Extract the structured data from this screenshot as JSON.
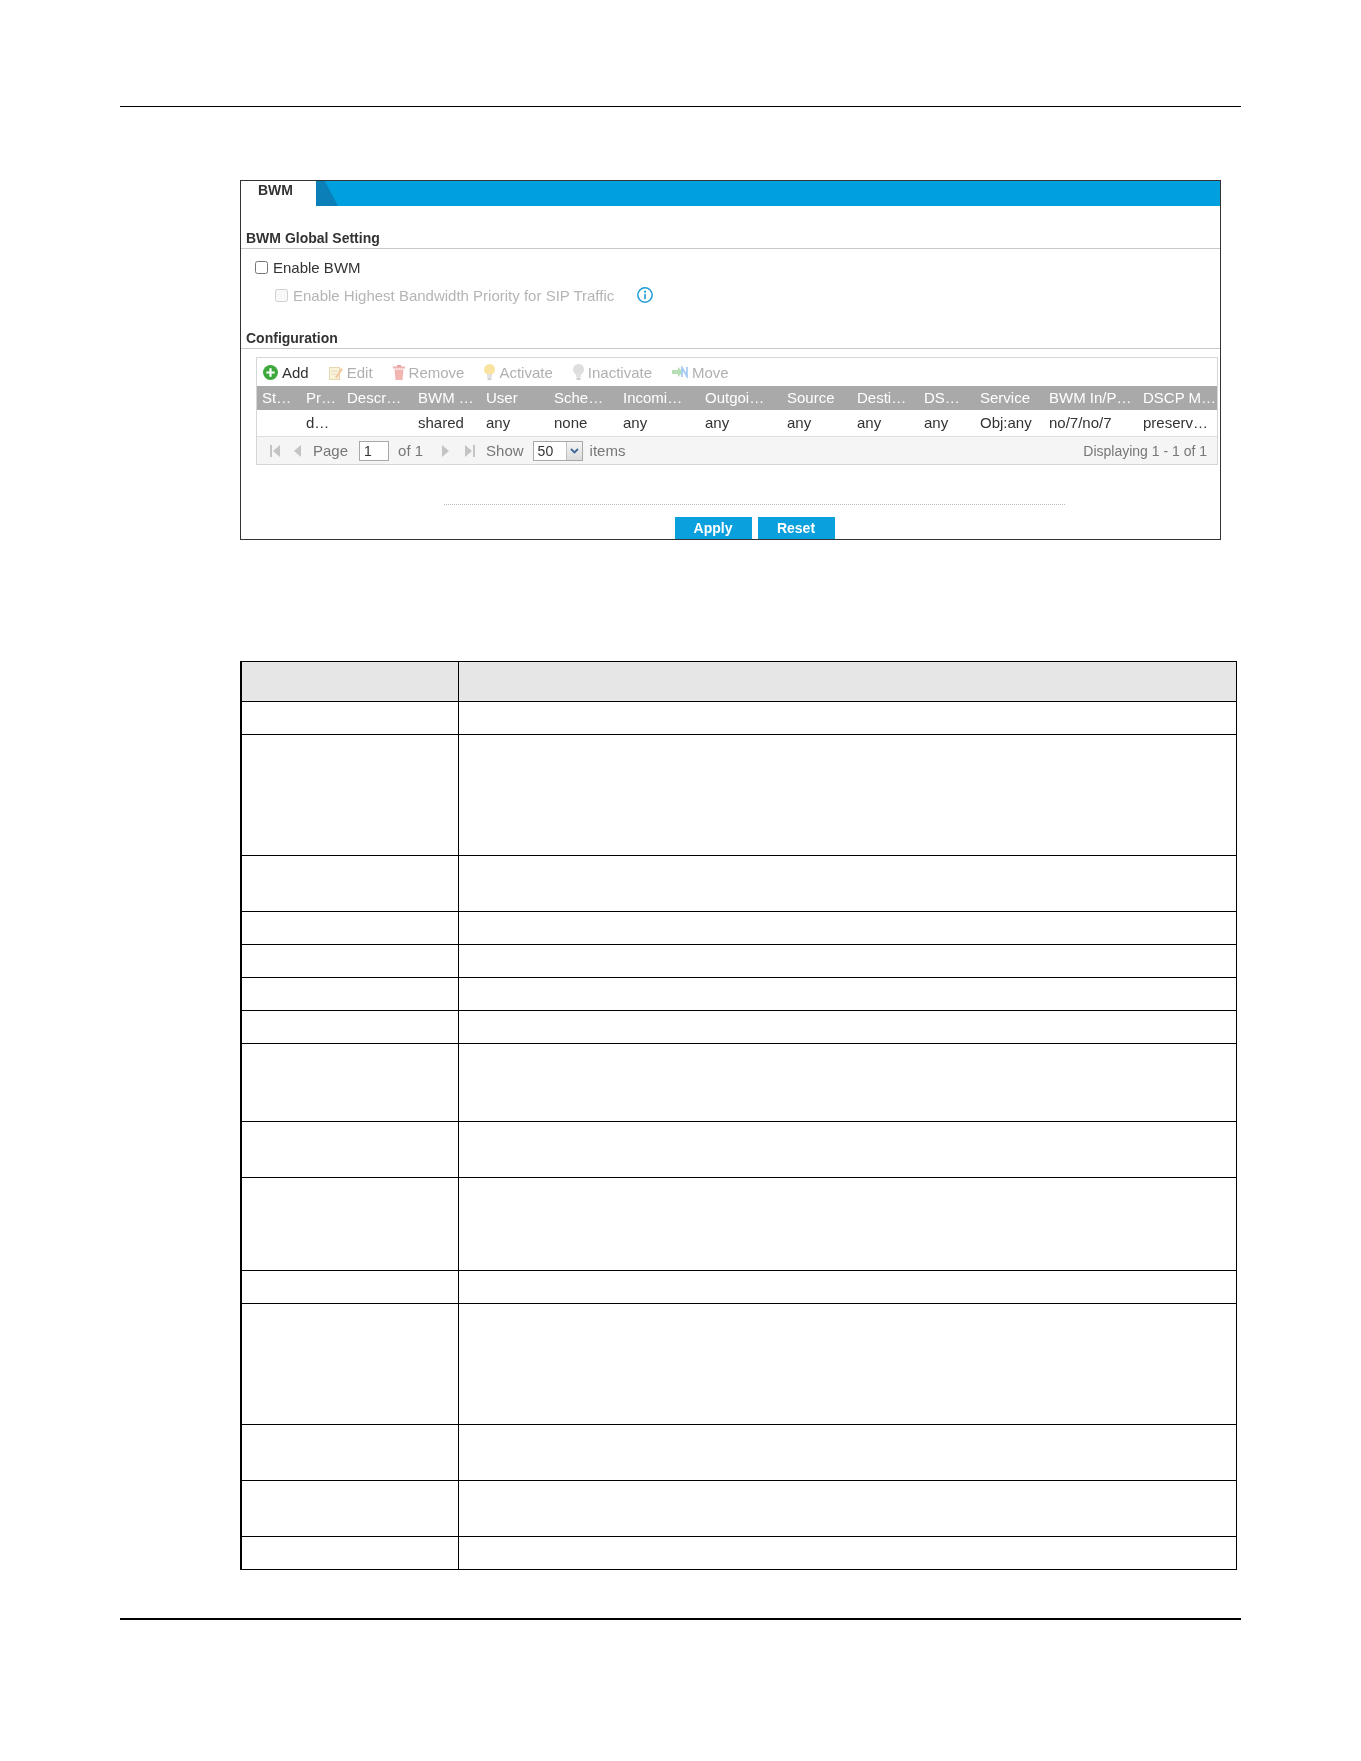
{
  "panel": {
    "tab": {
      "label": "BWM",
      "selected": true
    },
    "global_setting": {
      "title": "BWM Global Setting",
      "options": [
        {
          "label": "Enable BWM",
          "checked": false,
          "disabled": false,
          "info": false,
          "children": [
            {
              "label": "Enable Highest Bandwidth Priority for SIP Traffic",
              "checked": false,
              "disabled": true,
              "info": true
            }
          ]
        }
      ]
    },
    "configuration": {
      "title": "Configuration",
      "toolbar": [
        {
          "kind": "add",
          "label": "Add",
          "disabled": false
        },
        {
          "kind": "edit",
          "label": "Edit",
          "disabled": true
        },
        {
          "kind": "remove",
          "label": "Remove",
          "disabled": true
        },
        {
          "kind": "activate",
          "label": "Activate",
          "disabled": true
        },
        {
          "kind": "inactivate",
          "label": "Inactivate",
          "disabled": true
        },
        {
          "kind": "move",
          "label": "Move",
          "disabled": true
        }
      ],
      "columns": [
        "St…",
        "Pr…",
        "Descr…",
        "BWM …",
        "User",
        "Sche…",
        "Incomi…",
        "Outgoi…",
        "Source",
        "Desti…",
        "DS…",
        "Service",
        "BWM In/P…",
        "DSCP M…"
      ],
      "rows": [
        {
          "selected": false,
          "column_2": "d…",
          "column_4": "shared",
          "column_5": "any",
          "column_6": "none",
          "column_7": "any",
          "column_8": "any",
          "column_9": "any",
          "column_10": "any",
          "column_11": "any",
          "column_12": "Obj:any",
          "column_13": "no/7/no/7",
          "column_14": "preserv…"
        }
      ],
      "pager": {
        "back": [
          {
            "kind": "first",
            "disabled": true
          },
          {
            "kind": "previous",
            "disabled": true
          }
        ],
        "page_label": "Page",
        "page": "1",
        "page_count": "of 1",
        "forward": [
          {
            "kind": "next",
            "disabled": true
          },
          {
            "kind": "last",
            "disabled": true
          }
        ],
        "show_label": "Show",
        "per_page": "50",
        "items_label": "items",
        "summary": "Displaying 1 - 1 of 1"
      }
    },
    "buttons": [
      {
        "label": "Apply"
      },
      {
        "label": "Reset"
      }
    ]
  },
  "description_table": {
    "rows": [
      {
        "kind": "header"
      },
      {
        "kind": "single"
      },
      {
        "kind": "quint"
      },
      {
        "kind": "double"
      },
      {
        "kind": "single"
      },
      {
        "kind": "single"
      },
      {
        "kind": "single"
      },
      {
        "kind": "single"
      },
      {
        "kind": "triple"
      },
      {
        "kind": "double"
      },
      {
        "kind": "quad"
      },
      {
        "kind": "single"
      },
      {
        "kind": "quint"
      },
      {
        "kind": "double"
      },
      {
        "kind": "double"
      },
      {
        "kind": "single"
      }
    ]
  }
}
